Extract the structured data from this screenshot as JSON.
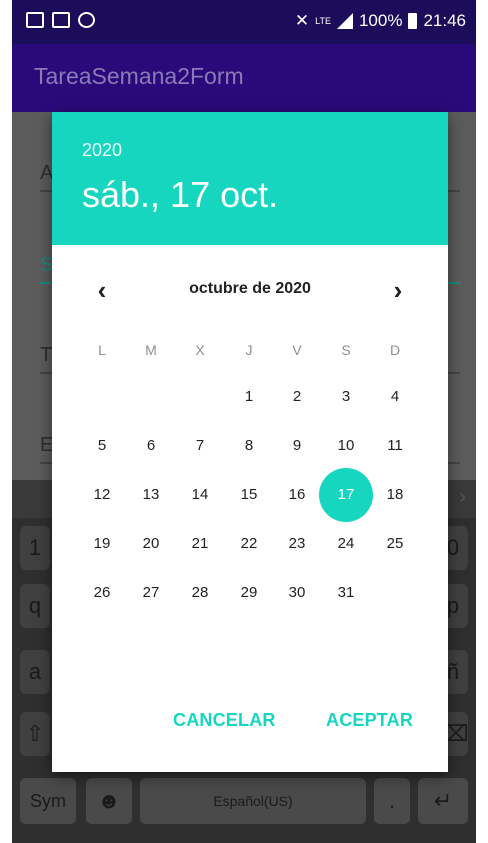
{
  "status_bar": {
    "battery": "100%",
    "time": "21:46",
    "network": "LTE"
  },
  "app": {
    "title": "TareaSemana2Form"
  },
  "form_hints": [
    "A",
    "S",
    "T",
    "E"
  ],
  "keyboard": {
    "row1": "1",
    "row1_end": "0",
    "row2": "q",
    "row2_end": "p",
    "row3": "a",
    "row3_end": "ñ",
    "sym": "Sym",
    "space": "Español(US)",
    "period": "."
  },
  "dialog": {
    "year": "2020",
    "date": "sáb., 17 oct.",
    "month_label": "octubre de 2020",
    "weekdays": [
      "L",
      "M",
      "X",
      "J",
      "V",
      "S",
      "D"
    ],
    "days": [
      "1",
      "2",
      "3",
      "4",
      "5",
      "6",
      "7",
      "8",
      "9",
      "10",
      "11",
      "12",
      "13",
      "14",
      "15",
      "16",
      "17",
      "18",
      "19",
      "20",
      "21",
      "22",
      "23",
      "24",
      "25",
      "26",
      "27",
      "28",
      "29",
      "30",
      "31"
    ],
    "selected_day": "17",
    "cancel": "CANCELAR",
    "ok": "ACEPTAR"
  },
  "colors": {
    "accent": "#16d6c0",
    "appbar": "#2a0a7a",
    "statusbar": "#1c0d5a"
  }
}
